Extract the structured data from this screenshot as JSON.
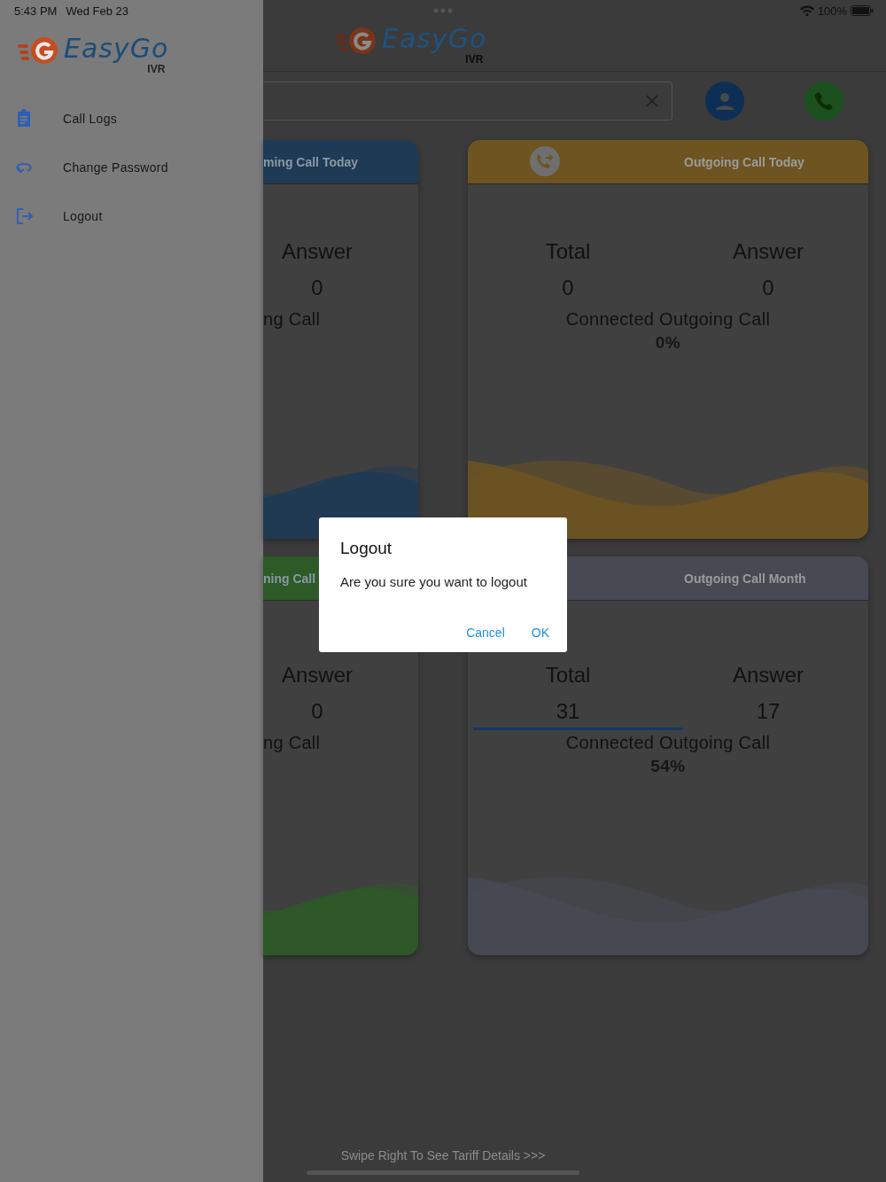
{
  "status_bar": {
    "time": "5:43 PM",
    "date": "Wed Feb 23",
    "battery": "100%"
  },
  "drawer": {
    "logo": {
      "name": "EasyGo",
      "sub": "IVR"
    },
    "items": [
      {
        "label": "Call Logs"
      },
      {
        "label": "Change Password"
      },
      {
        "label": "Logout"
      }
    ]
  },
  "header": {
    "logo": {
      "name": "EasyGo",
      "sub": "IVR"
    }
  },
  "cards": [
    {
      "title": "ming Call Today",
      "color": "#1e3a55",
      "cut": true,
      "stats": [
        {
          "label": "Answer",
          "value": "0"
        }
      ],
      "caption": "ng Call"
    },
    {
      "title": "Outgoing Call Today",
      "color": "#6e5420",
      "cut": false,
      "icon": true,
      "stats": [
        {
          "label": "Total",
          "value": "0"
        },
        {
          "label": "Answer",
          "value": "0"
        }
      ],
      "caption": "Connected Outgoing Call",
      "percent": "0%"
    },
    {
      "title": "ning Call",
      "color": "#2d5a27",
      "cut": true,
      "stats": [
        {
          "label": "Answer",
          "value": "0"
        }
      ],
      "caption": "ng Call"
    },
    {
      "title": "Outgoing Call Month",
      "color": "#474a53",
      "cut": false,
      "underline": true,
      "stats": [
        {
          "label": "Total",
          "value": "31"
        },
        {
          "label": "Answer",
          "value": "17"
        }
      ],
      "caption": "Connected Outgoing Call",
      "percent": "54%"
    }
  ],
  "hint": "Swipe Right To See Tariff Details >>>",
  "dialog": {
    "title": "Logout",
    "message": "Are you sure you want to logout",
    "buttons": [
      "Cancel",
      "OK"
    ]
  }
}
